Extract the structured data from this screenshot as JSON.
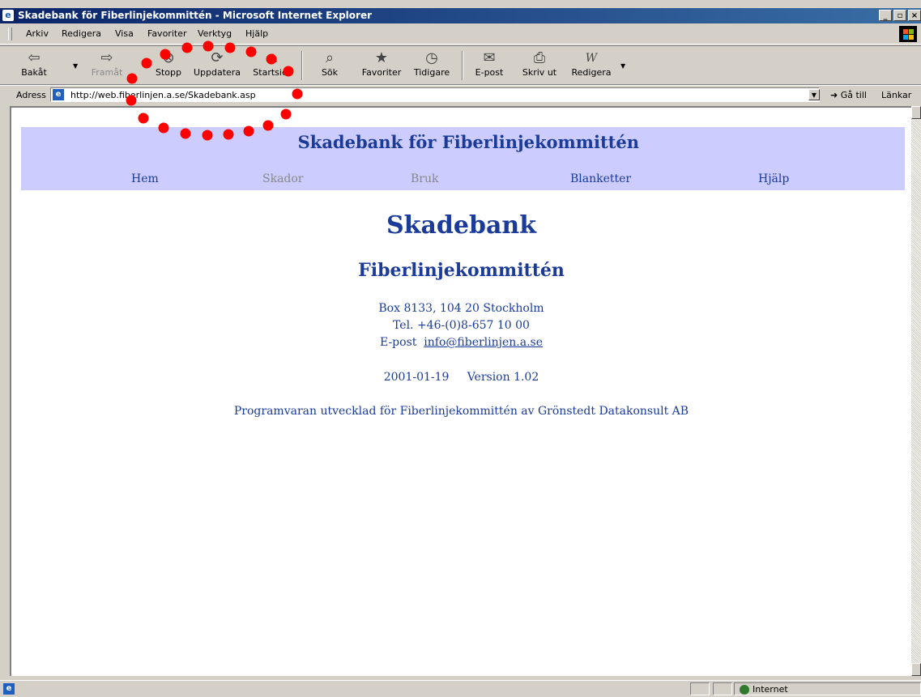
{
  "window": {
    "title": "Skadebank för Fiberlinjekommittén - Microsoft Internet Explorer",
    "buttons": [
      "_",
      "▫",
      "×"
    ]
  },
  "menu": [
    "Arkiv",
    "Redigera",
    "Visa",
    "Favoriter",
    "Verktyg",
    "Hjälp"
  ],
  "toolbar": {
    "back": "Bakåt",
    "forward": "Framåt",
    "stop": "Stopp",
    "refresh": "Uppdatera",
    "home": "Startsida",
    "search": "Sök",
    "favorites": "Favoriter",
    "history": "Tidigare",
    "mail": "E-post",
    "print": "Skriv ut",
    "edit": "Redigera"
  },
  "address": {
    "label": "Adress",
    "url": "http://web.fiberlinjen.a.se/Skadebank.asp",
    "go": "Gå till",
    "links": "Länkar"
  },
  "page": {
    "banner_title": "Skadebank för Fiberlinjekommittén",
    "nav": [
      "Hem",
      "Skador",
      "Bruk",
      "Blanketter",
      "Hjälp"
    ],
    "heading": "Skadebank",
    "subheading": "Fiberlinjekommittén",
    "address_line": "Box 8133, 104 20 Stockholm",
    "phone_line": "Tel. +46-(0)8-657 10 00",
    "email_label": "E-post",
    "email": "info@fiberlinjen.a.se",
    "date": "2001-01-19",
    "version": "Version 1.02",
    "footer": "Programvaran utvecklad för Fiberlinjekommittén av Grönstedt Datakonsult AB"
  },
  "status": {
    "zone": "Internet"
  },
  "colors": {
    "titlebar": "#0a246a",
    "banner": "#ccccff",
    "link": "#1a3b99",
    "annotation_dots": "#ff0000"
  }
}
